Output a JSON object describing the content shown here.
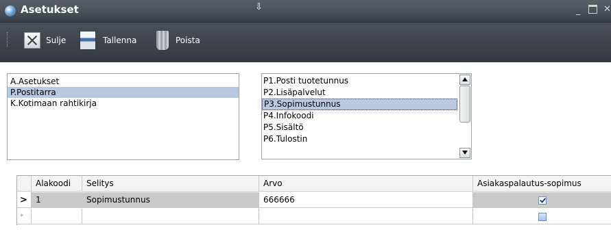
{
  "window": {
    "title": "Asetukset",
    "icon": "app-globe-icon"
  },
  "toolbar": {
    "close_label": "Sulje",
    "save_label": "Tallenna",
    "delete_label": "Poista"
  },
  "category_list": {
    "items": [
      "A.Asetukset",
      "P.Postitarra",
      "K.Kotimaan rahtikirja"
    ],
    "selected": "P.Postitarra"
  },
  "parameter_list": {
    "items": [
      "P1.Posti tuotetunnus",
      "P2.Lisäpalvelut",
      "P3.Sopimustunnus",
      "P4.Infokoodi",
      "P5.Sisältö",
      "P6.Tulostin"
    ],
    "selected": "P3.Sopimustunnus"
  },
  "grid": {
    "columns": [
      "Alakoodi",
      "Selitys",
      "Arvo",
      "Asiakaspalautus-sopimus"
    ],
    "rows": [
      {
        "indicator": ">",
        "alakoodi": "1",
        "selitys": "Sopimustunnus",
        "arvo": "666666",
        "asiakaspalautus": true
      }
    ],
    "new_row_indicator": "*"
  },
  "colors": {
    "titlebar": "#4a4e55",
    "selection": "#b8c8e0"
  }
}
